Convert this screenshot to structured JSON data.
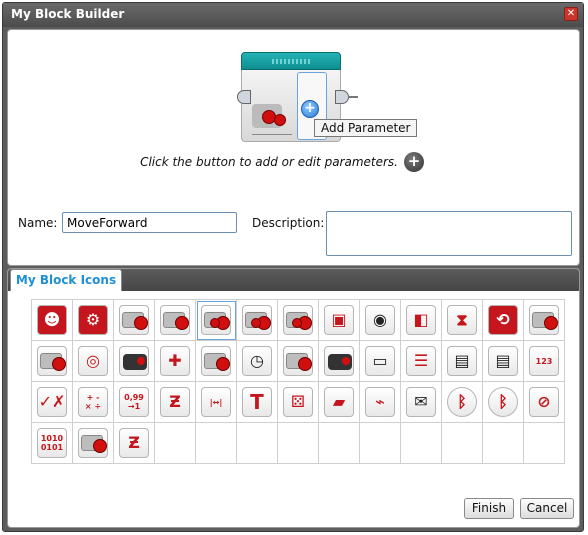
{
  "window": {
    "title": "My Block Builder",
    "close_icon": "close-icon"
  },
  "preview": {
    "tooltip": "Add Parameter",
    "hint": "Click the button to add or edit parameters.",
    "add_parameter_icon": "plus-icon"
  },
  "form": {
    "name_label": "Name:",
    "name_value": "MoveForward",
    "description_label": "Description:",
    "description_value": ""
  },
  "icons_tab": {
    "label": "My Block Icons"
  },
  "icon_grid": {
    "selected_index": 4,
    "rows": [
      [
        "brain-icon",
        "brain-gears-icon",
        "medium-motor-icon",
        "large-motor-icon",
        "move-tank-icon",
        "move-steering-icon",
        "motor-pair-icon",
        "brick-buttons-icon",
        "sound-icon",
        "color-sensor-icon",
        "timer-hourglass-icon",
        "loop-interrupt-icon",
        "sensor-cable-icon"
      ],
      [
        "touch-sensor-icon",
        "ultrasonic-box-icon",
        "infrared-sensor-icon",
        "directional-pad-icon",
        "gyro-sensor-icon",
        "timer-clock-icon",
        "medium-motor-gray-icon",
        "brick-status-icon",
        "battery-icon",
        "file-stack-icon",
        "briefcase-icon",
        "locked-briefcase-icon",
        "number-array-icon"
      ],
      [
        "math-check-cross-icon",
        "math-operators-icon",
        "round-number-icon",
        "random-zigzag-icon",
        "range-arrows-icon",
        "text-T-icon",
        "dice-icon",
        "folder-icon",
        "data-logging-icon",
        "envelope-icon",
        "bluetooth-icon",
        "bluetooth-wrench-icon",
        "no-connection-icon"
      ],
      [
        "binary-icon",
        "motor-rotation-icon",
        "red-random-icon"
      ]
    ],
    "glyphs": {
      "number-array-icon": "123",
      "math-operators-icon": "+ -\n× ÷",
      "round-number-icon": "0,99\n→1",
      "text-T-icon": "T",
      "binary-icon": "1010\n0101",
      "range-arrows-icon": "|↔|"
    }
  },
  "actions": {
    "finish_label": "Finish",
    "cancel_label": "Cancel"
  },
  "colors": {
    "accent": "#1f8fd6",
    "brand_red": "#c4161c",
    "teal": "#1aa3a6"
  }
}
